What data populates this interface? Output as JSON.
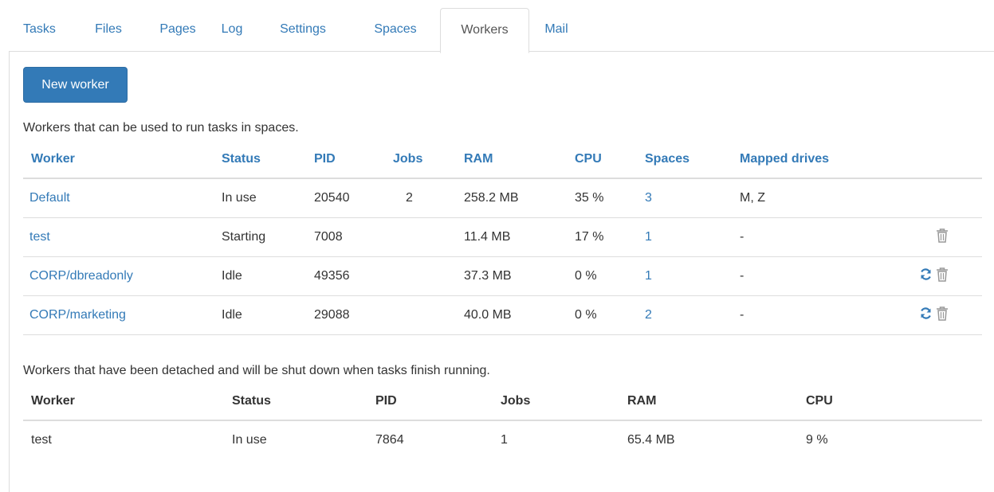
{
  "tabs": [
    {
      "label": "Tasks"
    },
    {
      "label": "Files"
    },
    {
      "label": "Pages"
    },
    {
      "label": "Log"
    },
    {
      "label": "Settings"
    },
    {
      "label": "Spaces"
    },
    {
      "label": "Workers",
      "active": true
    },
    {
      "label": "Mail"
    }
  ],
  "new_worker_label": "New worker",
  "active_section": {
    "caption": "Workers that can be used to run tasks in spaces.",
    "headers": [
      "Worker",
      "Status",
      "PID",
      "Jobs",
      "RAM",
      "CPU",
      "Spaces",
      "Mapped drives"
    ],
    "rows": [
      {
        "worker": "Default",
        "status": "In use",
        "pid": "20540",
        "jobs": "2",
        "ram": "258.2 MB",
        "cpu": "35 %",
        "spaces": "3",
        "drives": "M, Z",
        "restart": false,
        "delete": false
      },
      {
        "worker": "test",
        "status": "Starting",
        "pid": "7008",
        "jobs": "",
        "ram": "11.4 MB",
        "cpu": "17 %",
        "spaces": "1",
        "drives": "-",
        "restart": false,
        "delete": true
      },
      {
        "worker": "CORP/dbreadonly",
        "status": "Idle",
        "pid": "49356",
        "jobs": "",
        "ram": "37.3 MB",
        "cpu": "0 %",
        "spaces": "1",
        "drives": "-",
        "restart": true,
        "delete": true
      },
      {
        "worker": "CORP/marketing",
        "status": "Idle",
        "pid": "29088",
        "jobs": "",
        "ram": "40.0 MB",
        "cpu": "0 %",
        "spaces": "2",
        "drives": "-",
        "restart": true,
        "delete": true
      }
    ]
  },
  "detached_section": {
    "caption": "Workers that have been detached and will be shut down when tasks finish running.",
    "headers": [
      "Worker",
      "Status",
      "PID",
      "Jobs",
      "RAM",
      "CPU"
    ],
    "rows": [
      {
        "worker": "test",
        "status": "In use",
        "pid": "7864",
        "jobs": "1",
        "ram": "65.4 MB",
        "cpu": "9 %"
      }
    ]
  },
  "icons": {
    "restart": "refresh-icon",
    "delete": "trash-icon"
  },
  "colors": {
    "link": "#337ab7",
    "button": "#337ab7",
    "icon": "#337ab7",
    "trash": "#999999",
    "border": "#dddddd"
  }
}
